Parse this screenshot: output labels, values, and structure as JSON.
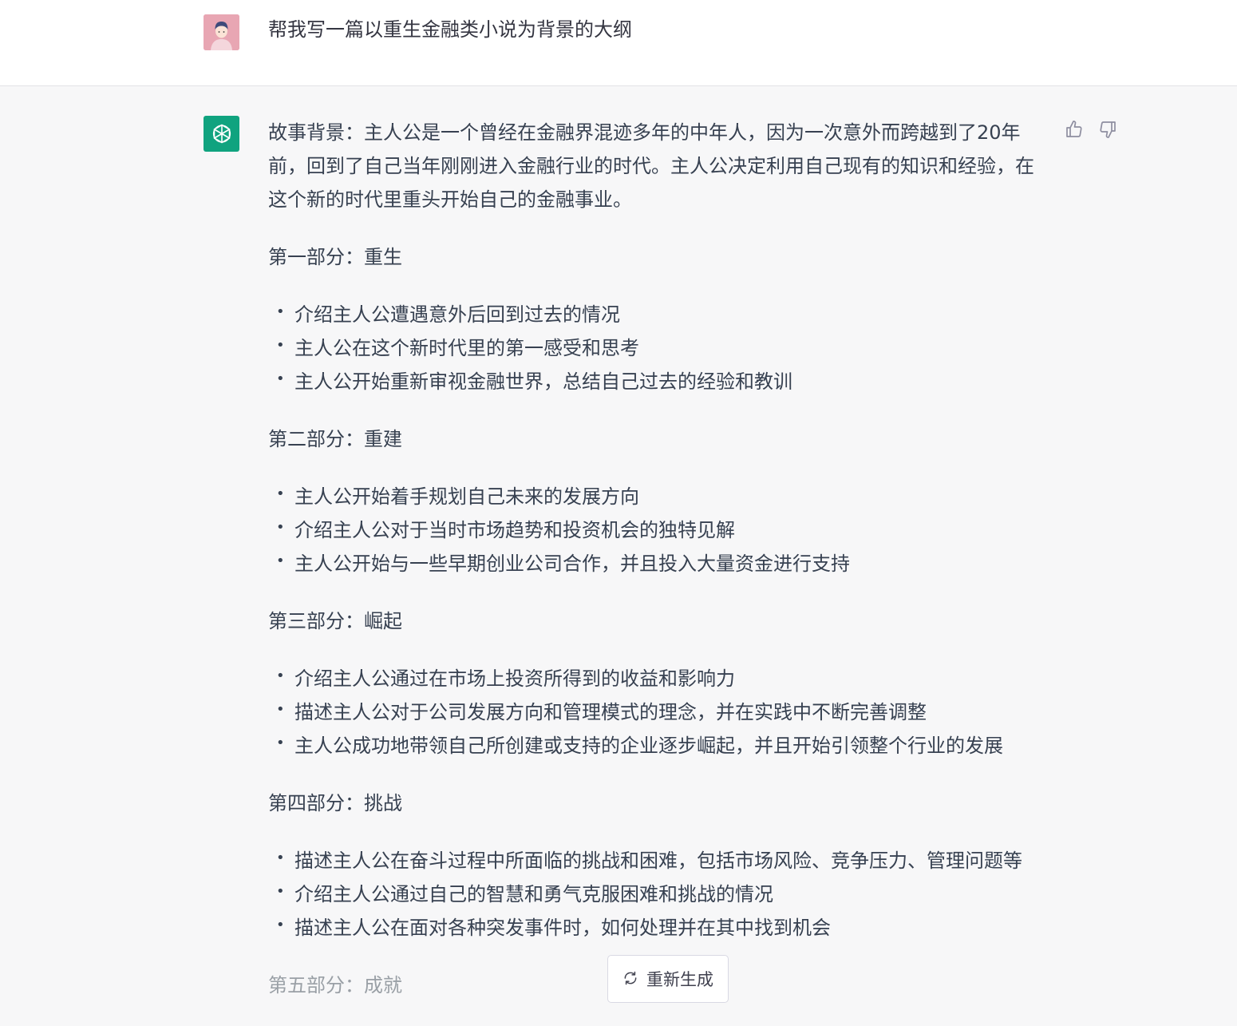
{
  "user_message": "帮我写一篇以重生金融类小说为背景的大纲",
  "assistant": {
    "intro": "故事背景：主人公是一个曾经在金融界混迹多年的中年人，因为一次意外而跨越到了20年前，回到了自己当年刚刚进入金融行业的时代。主人公决定利用自己现有的知识和经验，在这个新的时代里重头开始自己的金融事业。",
    "sections": [
      {
        "heading": "第一部分：重生",
        "items": [
          "介绍主人公遭遇意外后回到过去的情况",
          "主人公在这个新时代里的第一感受和思考",
          "主人公开始重新审视金融世界，总结自己过去的经验和教训"
        ]
      },
      {
        "heading": "第二部分：重建",
        "items": [
          "主人公开始着手规划自己未来的发展方向",
          "介绍主人公对于当时市场趋势和投资机会的独特见解",
          "主人公开始与一些早期创业公司合作，并且投入大量资金进行支持"
        ]
      },
      {
        "heading": "第三部分：崛起",
        "items": [
          "介绍主人公通过在市场上投资所得到的收益和影响力",
          "描述主人公对于公司发展方向和管理模式的理念，并在实践中不断完善调整",
          "主人公成功地带领自己所创建或支持的企业逐步崛起，并且开始引领整个行业的发展"
        ]
      },
      {
        "heading": "第四部分：挑战",
        "items": [
          "描述主人公在奋斗过程中所面临的挑战和困难，包括市场风险、竞争压力、管理问题等",
          "介绍主人公通过自己的智慧和勇气克服困难和挑战的情况",
          "描述主人公在面对各种突发事件时，如何处理并在其中找到机会"
        ]
      }
    ],
    "partial_heading": "第五部分：成就"
  },
  "regenerate_label": "重新生成",
  "colors": {
    "bot_avatar": "#10a37f",
    "background": "#f7f7f8",
    "user_row": "#ffffff"
  },
  "icons": {
    "like": "thumbs-up-icon",
    "dislike": "thumbs-down-icon",
    "regenerate": "refresh-icon",
    "bot": "openai-logo-icon"
  }
}
